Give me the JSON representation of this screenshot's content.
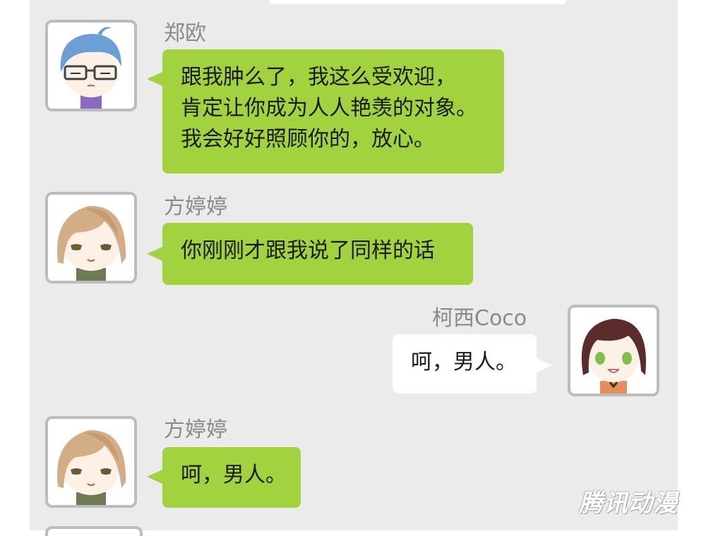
{
  "messages": [
    {
      "sender": "郑欧",
      "side": "left",
      "avatar": "blue-hair-glasses-avatar",
      "lines": [
        "跟我肿么了，我这么受欢迎，",
        "肯定让你成为人人艳羡的对象。",
        "我会好好照顾你的，放心。"
      ]
    },
    {
      "sender": "方婷婷",
      "side": "left",
      "avatar": "light-brown-hair-avatar",
      "lines": [
        "你刚刚才跟我说了同样的话"
      ]
    },
    {
      "sender": "柯西Coco",
      "side": "right",
      "avatar": "dark-brown-hair-avatar",
      "lines": [
        "呵，男人。"
      ]
    },
    {
      "sender": "方婷婷",
      "side": "left",
      "avatar": "light-brown-hair-avatar",
      "lines": [
        "呵，男人。"
      ]
    }
  ],
  "watermark": "腾讯动漫",
  "colors": {
    "background": "#ebebeb",
    "bubble_green": "#a2d23e",
    "bubble_white": "#ffffff",
    "name_text": "#8a8a8a",
    "avatar_border": "#bcbcbc"
  }
}
